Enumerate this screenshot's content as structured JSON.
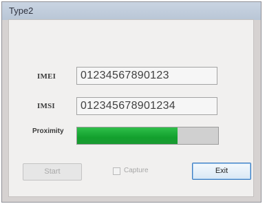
{
  "window": {
    "title": "Type2"
  },
  "fields": {
    "imei": {
      "label": "IMEI",
      "value": "01234567890123"
    },
    "imsi": {
      "label": "IMSI",
      "value": "012345678901234"
    }
  },
  "proximity": {
    "label": "Proximity",
    "level_percent": 71
  },
  "buttons": {
    "start_label": "Start",
    "exit_label": "Exit"
  },
  "capture": {
    "label": "Capture",
    "checked": false
  }
}
